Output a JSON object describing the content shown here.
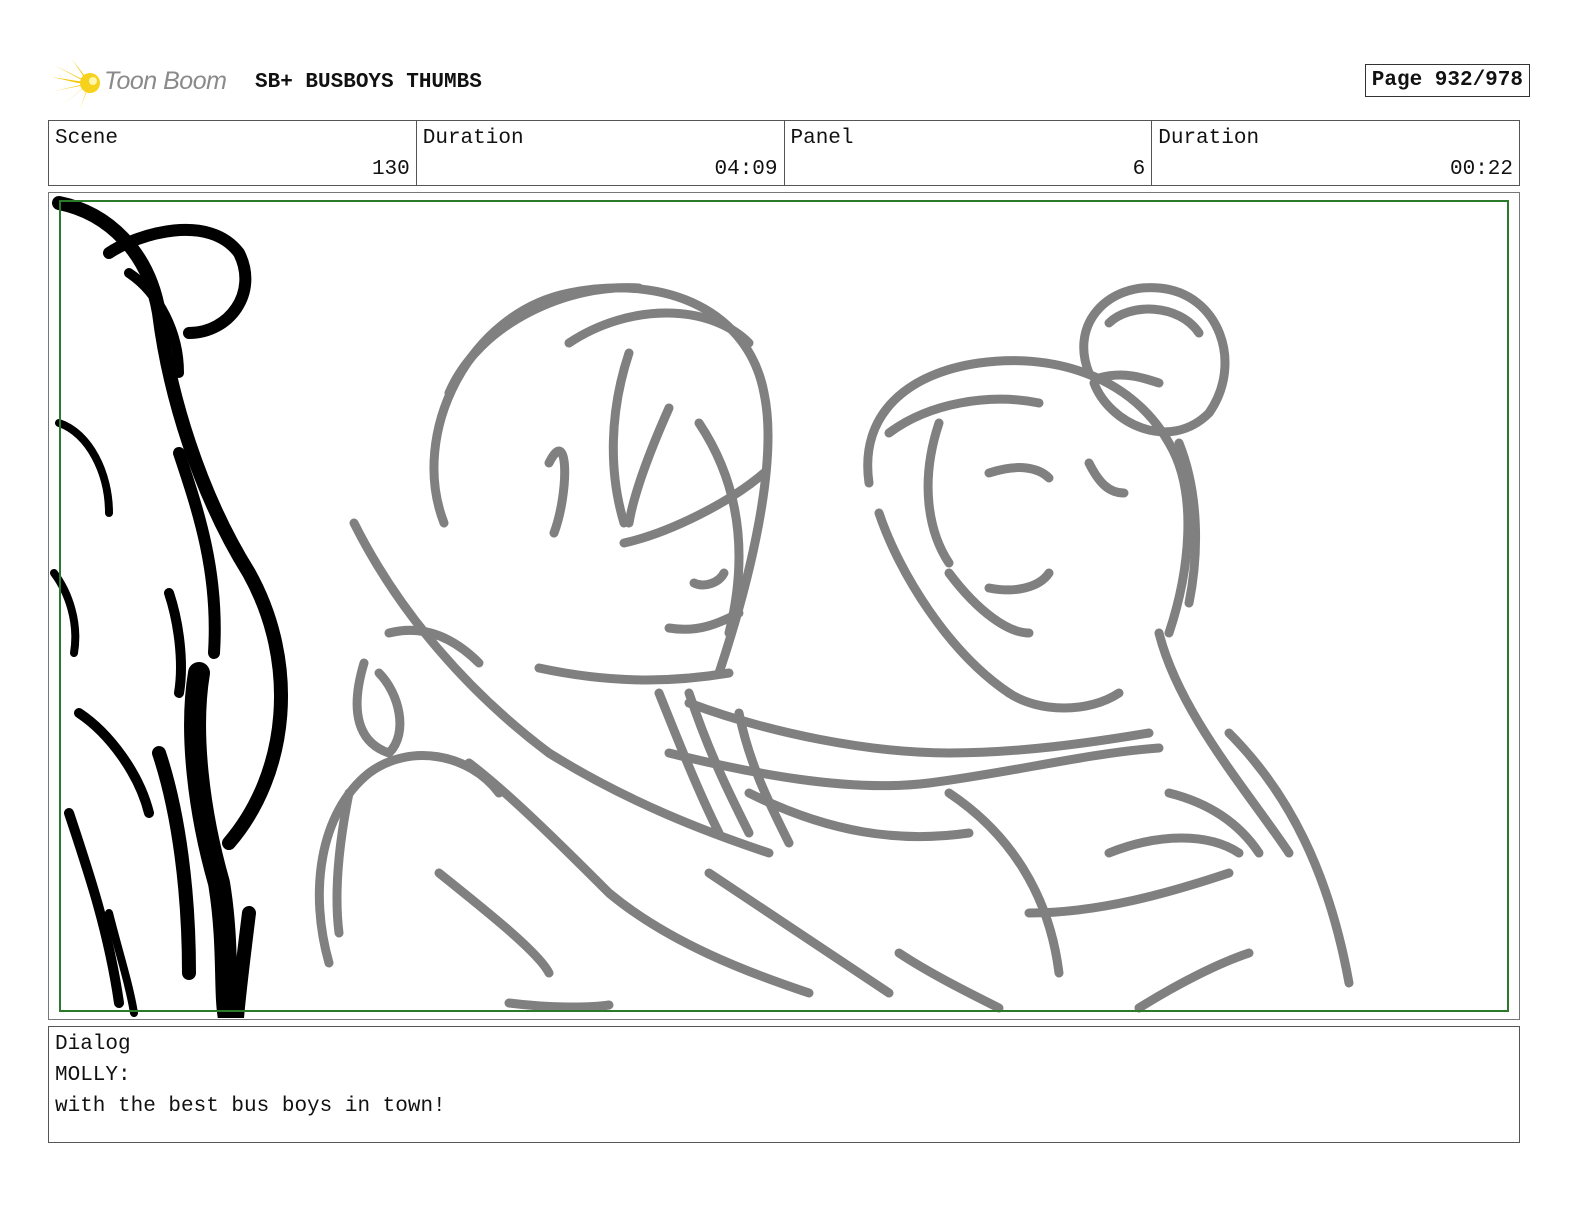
{
  "header": {
    "logo_text": "Toon Boom",
    "title": "SB+ BUSBOYS THUMBS",
    "page": "Page 932/978"
  },
  "info": [
    {
      "label": "Scene",
      "value": "130"
    },
    {
      "label": "Duration",
      "value": "04:09"
    },
    {
      "label": "Panel",
      "value": "6"
    },
    {
      "label": "Duration",
      "value": "00:22"
    }
  ],
  "panel": {
    "sketch_color": "#808080",
    "foreground_color": "#000000",
    "safe_area_color": "#2a7a2a"
  },
  "dialog": {
    "label": "Dialog",
    "speaker": "MOLLY:",
    "line": "with the best bus boys in town!"
  }
}
